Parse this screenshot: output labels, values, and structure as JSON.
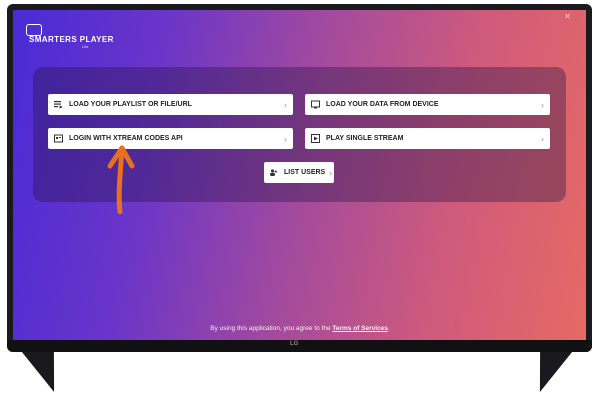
{
  "app": {
    "logo_text": "SMARTERS PLAYER",
    "logo_sub": "Lite"
  },
  "menu": {
    "load_playlist": "LOAD YOUR PLAYLIST OR FILE/URL",
    "load_data": "LOAD YOUR DATA FROM DEVICE",
    "login_xtream": "LOGIN WITH XTREAM CODES API",
    "play_single": "PLAY SINGLE STREAM",
    "list_users": "LIST USERS"
  },
  "footer": {
    "text": "By using this application, you agree to the ",
    "link": "Terms of Services",
    "suffix": "."
  },
  "tv": {
    "brand": "LG"
  },
  "colors": {
    "arrow": "#e8711f",
    "bg_start": "#4a2bd6",
    "bg_end": "#e56a64"
  }
}
